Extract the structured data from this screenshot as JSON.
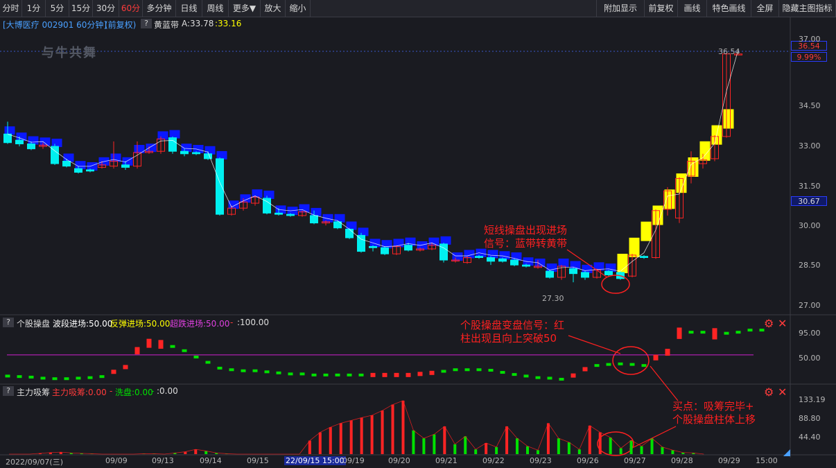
{
  "toolbar": {
    "left": [
      "分时",
      "1分",
      "5分",
      "15分",
      "30分",
      "60分",
      "多分钟",
      "日线",
      "周线",
      "更多▼",
      "放大",
      "缩小"
    ],
    "active": "60分",
    "right": [
      "附加显示",
      "前复权",
      "画线",
      "特色画线",
      "全屏",
      "隐藏主图指标"
    ]
  },
  "main_header": {
    "stock": "[大博医疗 002901 60分钟]",
    "adjust": "(前复权)",
    "indicator": "黄蓝带",
    "a_label": "A:33.78",
    "a_value": ":33.16"
  },
  "watermark": "与牛共舞",
  "price_boxes": {
    "last": "36.54",
    "pct": "9.99%",
    "mid": "30.67"
  },
  "peak_label": "36.54",
  "low_label": "27.30",
  "ind1_header": {
    "name": "个股操盘",
    "wave": "波段进场:50.00",
    "rebound": "反弹进场:50.00",
    "oversold": "超跌进场:50.00",
    "top": ":100.00"
  },
  "ind2_header": {
    "name": "主力吸筹",
    "absorb": "主力吸筹:0.00",
    "wash": "洗盘:0.00",
    "zero": ":0.00"
  },
  "annotations": {
    "a1_l1": "短线操盘出现进场",
    "a1_l2": "信号：蓝带转黄带",
    "a2_l1": "个股操盘变盘信号：红",
    "a2_l2": "柱出现且向上突破50",
    "a3_l1": "买点：吸筹完毕+",
    "a3_l2": "个股操盘柱体上移"
  },
  "y_axis_main": [
    "37.00",
    "34.50",
    "33.00",
    "31.50",
    "30.00",
    "28.50",
    "27.00"
  ],
  "y_axis_ind1": [
    "95.00",
    "50.00"
  ],
  "y_axis_ind2": [
    "133.19",
    "88.80",
    "44.40"
  ],
  "x_axis": [
    "2022/09/07(三)",
    "09/09",
    "09/13",
    "09/14",
    "09/15",
    "22/09/15 15:00",
    "09/19",
    "09/20",
    "09/21",
    "09/22",
    "09/23",
    "09/26",
    "09/27",
    "09/28",
    "09/29",
    "15:00"
  ],
  "colors": {
    "up": "#ff2424",
    "down": "#00f0f0",
    "blue_band": "#0a18ff",
    "yellow_band": "#ffff00",
    "green": "#00e000",
    "magenta": "#d020d0",
    "bg": "#1a1b21"
  },
  "chart_data": {
    "type": "candlestick",
    "title": "大博医疗 002901 60分钟",
    "ylim": [
      26.5,
      37.6
    ],
    "candles": [
      {
        "o": 33.3,
        "c": 32.95,
        "h": 33.8,
        "l": 32.9
      },
      {
        "o": 33.05,
        "c": 32.9,
        "h": 33.2,
        "l": 32.8
      },
      {
        "o": 32.9,
        "c": 32.7,
        "h": 33.0,
        "l": 32.65
      },
      {
        "o": 32.8,
        "c": 32.85,
        "h": 32.95,
        "l": 32.7
      },
      {
        "o": 32.8,
        "c": 32.1,
        "h": 32.9,
        "l": 32.05
      },
      {
        "o": 32.2,
        "c": 32.0,
        "h": 32.3,
        "l": 31.95
      },
      {
        "o": 31.9,
        "c": 31.75,
        "h": 32.0,
        "l": 31.7
      },
      {
        "o": 31.85,
        "c": 31.8,
        "h": 31.9,
        "l": 31.75
      },
      {
        "o": 31.95,
        "c": 32.05,
        "h": 32.2,
        "l": 31.9
      },
      {
        "o": 32.0,
        "c": 32.2,
        "h": 33.0,
        "l": 31.9
      },
      {
        "o": 32.05,
        "c": 31.95,
        "h": 32.2,
        "l": 31.85
      },
      {
        "o": 32.0,
        "c": 32.55,
        "h": 33.0,
        "l": 31.9
      },
      {
        "o": 32.55,
        "c": 32.6,
        "h": 32.8,
        "l": 32.5
      },
      {
        "o": 32.6,
        "c": 33.1,
        "h": 33.2,
        "l": 32.5
      },
      {
        "o": 33.15,
        "c": 32.6,
        "h": 33.2,
        "l": 32.5
      },
      {
        "o": 32.6,
        "c": 32.5,
        "h": 32.7,
        "l": 32.4
      },
      {
        "o": 32.55,
        "c": 32.5,
        "h": 32.6,
        "l": 32.45
      },
      {
        "o": 32.5,
        "c": 32.3,
        "h": 32.6,
        "l": 32.25
      },
      {
        "o": 32.3,
        "c": 30.05,
        "h": 32.35,
        "l": 30.0
      },
      {
        "o": 30.05,
        "c": 30.3,
        "h": 30.4,
        "l": 30.0
      },
      {
        "o": 30.3,
        "c": 30.55,
        "h": 30.7,
        "l": 30.2
      },
      {
        "o": 30.5,
        "c": 30.75,
        "h": 30.8,
        "l": 30.4
      },
      {
        "o": 30.7,
        "c": 30.1,
        "h": 30.8,
        "l": 30.05
      },
      {
        "o": 30.1,
        "c": 30.05,
        "h": 30.3,
        "l": 30.0
      },
      {
        "o": 30.05,
        "c": 30.0,
        "h": 30.1,
        "l": 29.95
      },
      {
        "o": 30.0,
        "c": 30.15,
        "h": 30.2,
        "l": 29.95
      },
      {
        "o": 30.0,
        "c": 29.7,
        "h": 30.2,
        "l": 29.65
      },
      {
        "o": 29.7,
        "c": 29.75,
        "h": 29.8,
        "l": 29.6
      },
      {
        "o": 29.75,
        "c": 29.5,
        "h": 29.8,
        "l": 29.45
      },
      {
        "o": 29.45,
        "c": 29.1,
        "h": 29.5,
        "l": 29.05
      },
      {
        "o": 29.2,
        "c": 28.55,
        "h": 29.3,
        "l": 28.5
      },
      {
        "o": 28.75,
        "c": 28.7,
        "h": 28.8,
        "l": 28.55
      },
      {
        "o": 28.7,
        "c": 28.45,
        "h": 28.75,
        "l": 28.4
      },
      {
        "o": 28.45,
        "c": 28.75,
        "h": 28.8,
        "l": 28.4
      },
      {
        "o": 28.8,
        "c": 28.6,
        "h": 28.9,
        "l": 28.55
      },
      {
        "o": 28.6,
        "c": 28.65,
        "h": 28.7,
        "l": 28.55
      },
      {
        "o": 28.65,
        "c": 28.8,
        "h": 28.9,
        "l": 28.6
      },
      {
        "o": 28.85,
        "c": 28.2,
        "h": 28.9,
        "l": 28.1
      },
      {
        "o": 28.2,
        "c": 28.2,
        "h": 28.3,
        "l": 28.1
      },
      {
        "o": 28.1,
        "c": 28.3,
        "h": 28.35,
        "l": 28.05
      },
      {
        "o": 28.35,
        "c": 28.3,
        "h": 28.4,
        "l": 28.25
      },
      {
        "o": 28.3,
        "c": 28.15,
        "h": 28.35,
        "l": 28.0
      },
      {
        "o": 28.25,
        "c": 28.15,
        "h": 28.3,
        "l": 28.1
      },
      {
        "o": 28.2,
        "c": 28.0,
        "h": 28.25,
        "l": 27.95
      },
      {
        "o": 28.0,
        "c": 27.95,
        "h": 28.05,
        "l": 27.9
      },
      {
        "o": 27.9,
        "c": 27.95,
        "h": 28.2,
        "l": 27.85
      },
      {
        "o": 27.75,
        "c": 27.5,
        "h": 27.8,
        "l": 27.45
      },
      {
        "o": 27.5,
        "c": 27.95,
        "h": 28.0,
        "l": 27.4
      },
      {
        "o": 27.85,
        "c": 27.65,
        "h": 27.9,
        "l": 27.3
      },
      {
        "o": 27.7,
        "c": 27.5,
        "h": 27.75,
        "l": 27.4
      },
      {
        "o": 27.5,
        "c": 27.8,
        "h": 27.85,
        "l": 27.45
      },
      {
        "o": 27.75,
        "c": 27.6,
        "h": 27.8,
        "l": 27.55
      },
      {
        "o": 27.7,
        "c": 27.45,
        "h": 27.75,
        "l": 27.4
      },
      {
        "o": 27.55,
        "c": 28.4,
        "h": 28.45,
        "l": 27.5
      },
      {
        "o": 28.35,
        "c": 28.3,
        "h": 28.4,
        "l": 28.25
      },
      {
        "o": 28.3,
        "c": 30.2,
        "h": 30.25,
        "l": 28.25
      },
      {
        "o": 30.25,
        "c": 31.0,
        "h": 31.15,
        "l": 30.0
      },
      {
        "o": 29.9,
        "c": 31.5,
        "h": 31.55,
        "l": 29.7
      },
      {
        "o": 31.6,
        "c": 32.2,
        "h": 32.6,
        "l": 31.3
      },
      {
        "o": 32.1,
        "c": 32.25,
        "h": 32.5,
        "l": 31.9
      },
      {
        "o": 32.3,
        "c": 33.2,
        "h": 33.25,
        "l": 32.2
      },
      {
        "o": 33.2,
        "c": 36.54,
        "h": 36.54,
        "l": 33.15
      },
      {
        "o": 36.54,
        "c": 36.54,
        "h": 36.54,
        "l": 36.54
      }
    ],
    "band_blue_x": [
      0,
      51
    ],
    "band_yellow_x": [
      52,
      62
    ],
    "ind1_ylim": [
      0,
      105
    ],
    "ind1_values": [
      10,
      9,
      8,
      6,
      5,
      5,
      6,
      7,
      9,
      18,
      27,
      58,
      72,
      70,
      66,
      58,
      46,
      36,
      25,
      22,
      20,
      20,
      18,
      16,
      14,
      14,
      12,
      12,
      12,
      12,
      12,
      12,
      12,
      12,
      12,
      14,
      16,
      19,
      22,
      22,
      22,
      21,
      17,
      13,
      10,
      7,
      6,
      4,
      11,
      23,
      30,
      32,
      33,
      32,
      30,
      45,
      55,
      91,
      93,
      93,
      90,
      91,
      93,
      97,
      97
    ],
    "ind1_color": [
      "g",
      "g",
      "g",
      "g",
      "g",
      "g",
      "g",
      "g",
      "g",
      "r",
      "r",
      "r",
      "r",
      "r",
      "g",
      "g",
      "g",
      "g",
      "g",
      "g",
      "g",
      "g",
      "g",
      "g",
      "g",
      "g",
      "g",
      "g",
      "g",
      "g",
      "g",
      "r",
      "r",
      "r",
      "r",
      "r",
      "r",
      "g",
      "g",
      "g",
      "g",
      "g",
      "g",
      "g",
      "g",
      "g",
      "g",
      "g",
      "r",
      "r",
      "g",
      "g",
      "g",
      "g",
      "g",
      "r",
      "r",
      "r",
      "g",
      "g",
      "r",
      "g",
      "g",
      "g",
      "g"
    ],
    "ind1_line": 50,
    "ind2_ylim": [
      0,
      140
    ],
    "ind2_values": [
      0,
      0,
      0,
      2,
      4,
      5,
      3,
      2,
      1,
      0,
      0,
      0,
      0,
      1,
      1,
      0,
      3,
      6,
      12,
      8,
      3,
      1,
      0,
      0,
      0,
      0,
      0,
      0,
      0,
      34,
      55,
      68,
      78,
      85,
      92,
      98,
      110,
      125,
      135,
      60,
      40,
      50,
      70,
      25,
      45,
      12,
      28,
      18,
      70,
      40,
      20,
      10,
      78,
      40,
      30,
      12,
      72,
      55,
      42,
      15,
      35,
      20,
      40,
      18,
      10,
      4,
      3,
      0
    ],
    "ind2_color": [
      "g",
      "g",
      "g",
      "r",
      "r",
      "r",
      "g",
      "g",
      "g",
      "g",
      "g",
      "g",
      "g",
      "g",
      "g",
      "g",
      "g",
      "r",
      "r",
      "g",
      "g",
      "g",
      "g",
      "g",
      "g",
      "g",
      "g",
      "g",
      "g",
      "r",
      "r",
      "r",
      "r",
      "r",
      "r",
      "r",
      "r",
      "r",
      "r",
      "g",
      "g",
      "g",
      "r",
      "g",
      "g",
      "g",
      "r",
      "g",
      "r",
      "g",
      "g",
      "g",
      "r",
      "g",
      "g",
      "g",
      "r",
      "r",
      "g",
      "g",
      "g",
      "g",
      "g",
      "g",
      "g",
      "g",
      "g",
      "g"
    ]
  }
}
